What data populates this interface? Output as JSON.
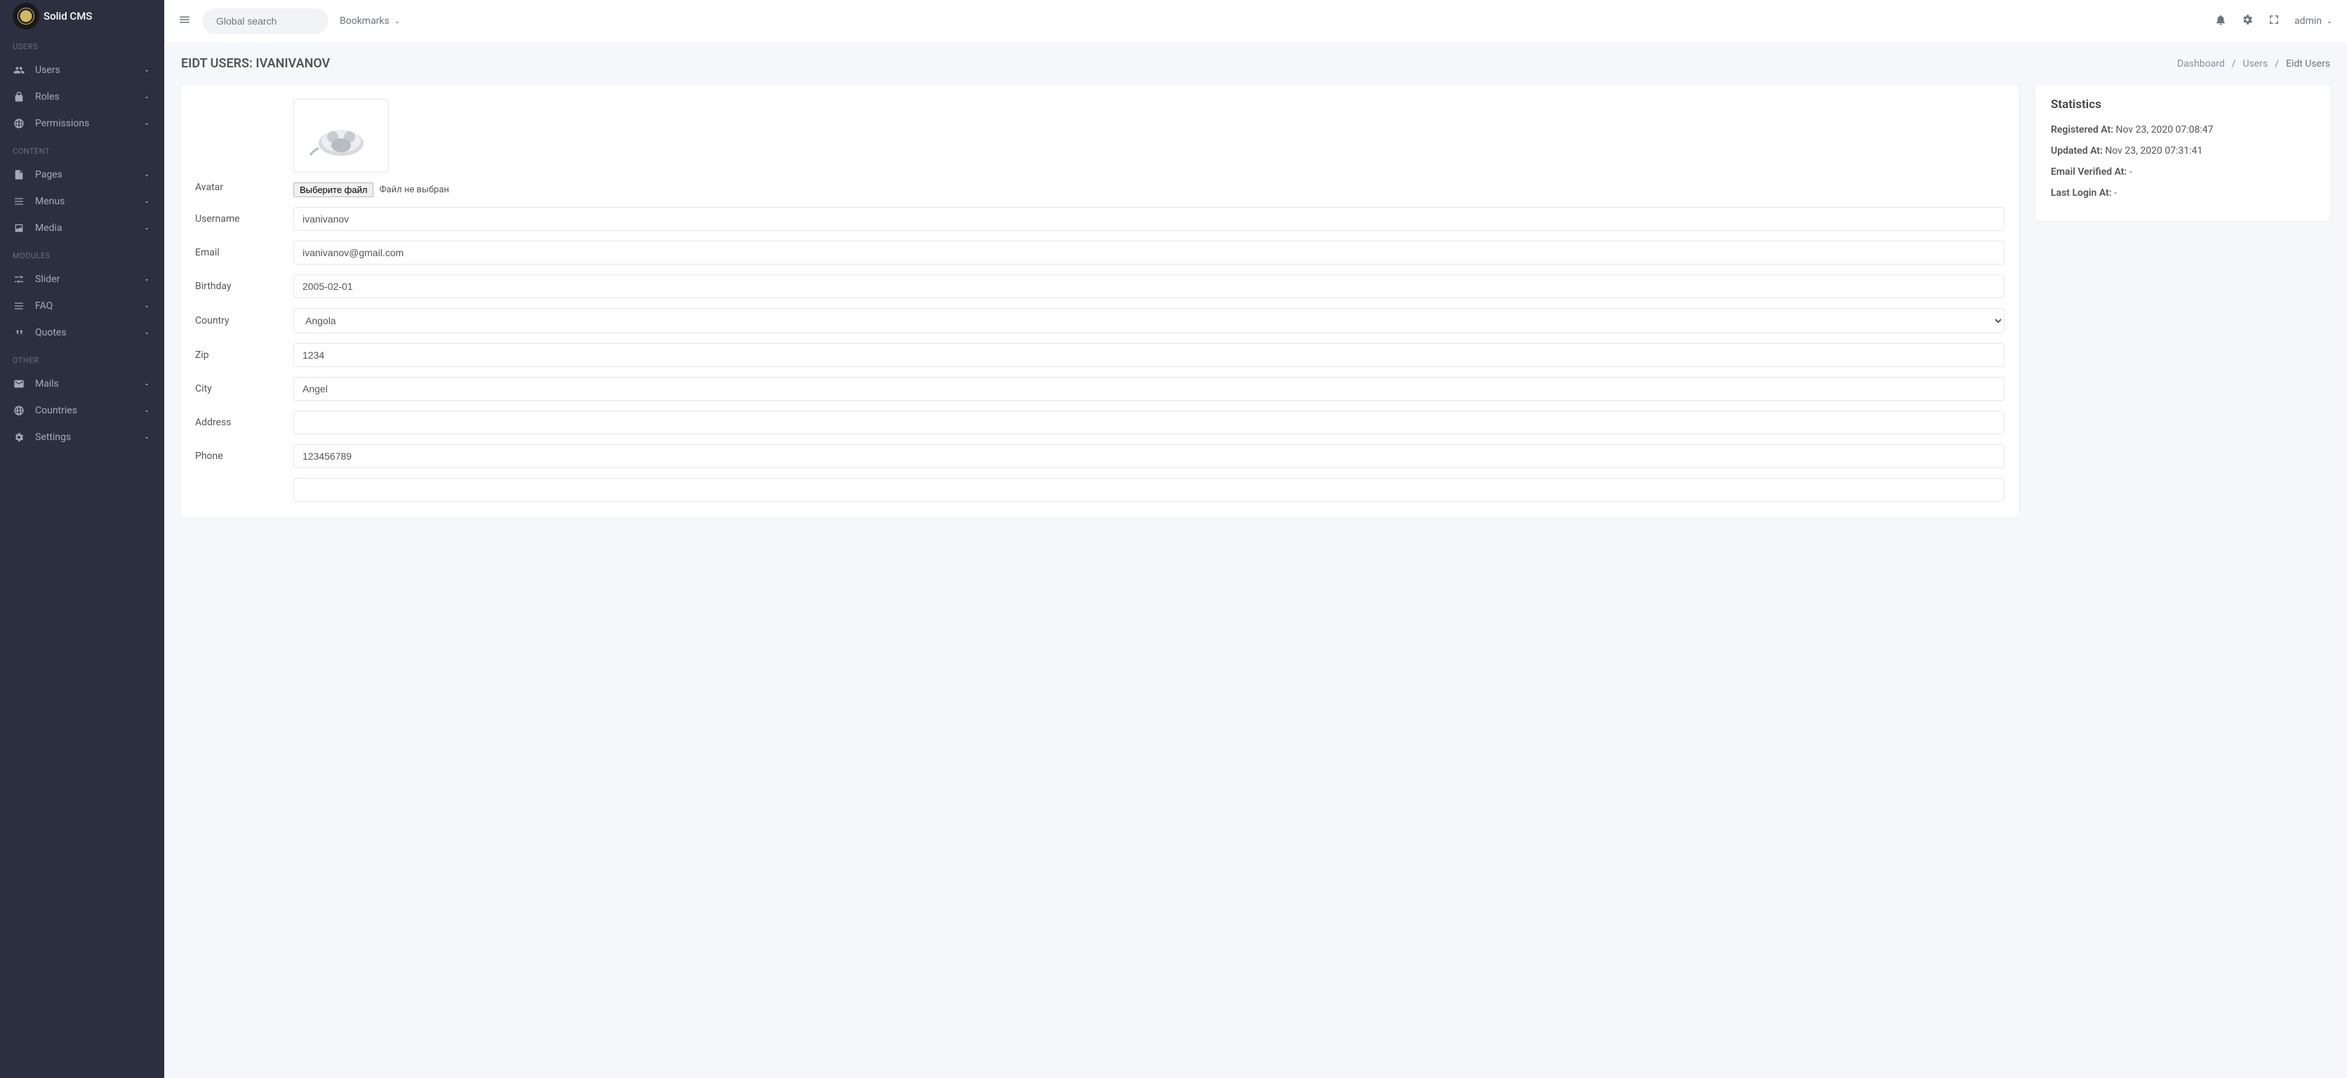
{
  "brand": {
    "name": "Solid CMS"
  },
  "topbar": {
    "search_placeholder": "Global search",
    "bookmarks_label": "Bookmarks",
    "user_label": "admin"
  },
  "sidebar": {
    "sections": [
      {
        "label": "USERS",
        "items": [
          {
            "icon": "users-icon",
            "label": "Users"
          },
          {
            "icon": "lock-icon",
            "label": "Roles"
          },
          {
            "icon": "globe-icon",
            "label": "Permissions"
          }
        ]
      },
      {
        "label": "CONTENT",
        "items": [
          {
            "icon": "file-icon",
            "label": "Pages"
          },
          {
            "icon": "list-icon",
            "label": "Menus"
          },
          {
            "icon": "media-icon",
            "label": "Media"
          }
        ]
      },
      {
        "label": "MODULES",
        "items": [
          {
            "icon": "sliders-icon",
            "label": "Slider"
          },
          {
            "icon": "list-icon",
            "label": "FAQ"
          },
          {
            "icon": "quote-icon",
            "label": "Quotes"
          }
        ]
      },
      {
        "label": "OTHER",
        "items": [
          {
            "icon": "mail-icon",
            "label": "Mails"
          },
          {
            "icon": "globe-icon",
            "label": "Countries"
          },
          {
            "icon": "gear-icon",
            "label": "Settings"
          }
        ]
      }
    ]
  },
  "page": {
    "title": "EIDT USERS: IVANIVANOV"
  },
  "breadcrumb": {
    "items": [
      "Dashboard",
      "Users",
      "Eidt Users"
    ]
  },
  "form": {
    "avatar_label": "Avatar",
    "file_button": "Выберите файл",
    "file_status": "Файл не выбран",
    "fields": {
      "username": {
        "label": "Username",
        "value": "ivanivanov"
      },
      "email": {
        "label": "Email",
        "value": "ivanivanov@gmail.com"
      },
      "birthday": {
        "label": "Birthday",
        "value": "2005-02-01"
      },
      "country": {
        "label": "Country",
        "value": "Angola"
      },
      "zip": {
        "label": "Zip",
        "value": "1234"
      },
      "city": {
        "label": "City",
        "value": "Angel"
      },
      "address": {
        "label": "Address",
        "value": ""
      },
      "phone": {
        "label": "Phone",
        "value": "123456789"
      }
    }
  },
  "stats": {
    "title": "Statistics",
    "registered_label": "Registered At:",
    "registered_value": "Nov 23, 2020 07:08:47",
    "updated_label": "Updated At:",
    "updated_value": "Nov 23, 2020 07:31:41",
    "verified_label": "Email Verified At:",
    "verified_value": "-",
    "lastlogin_label": "Last Login At:",
    "lastlogin_value": "-"
  }
}
